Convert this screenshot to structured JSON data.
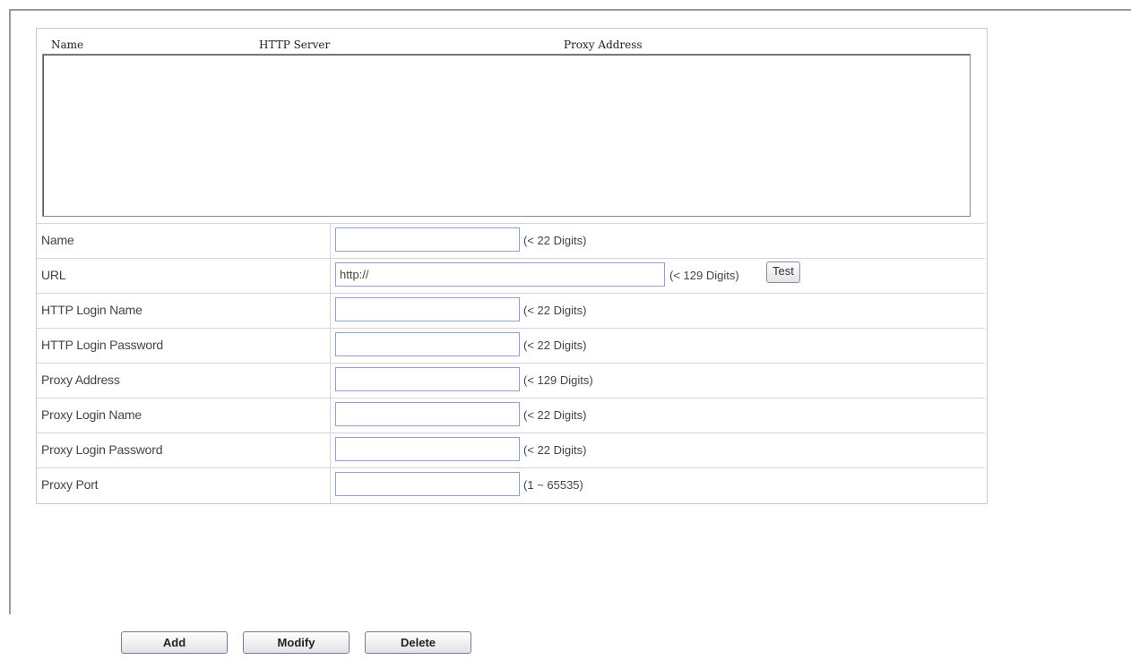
{
  "list": {
    "columns": [
      "Name",
      "HTTP Server",
      "Proxy Address"
    ]
  },
  "form": {
    "rows": [
      {
        "label": "Name",
        "value": "",
        "hint": "(< 22 Digits)"
      },
      {
        "label": "URL",
        "value": "http://",
        "hint": "(< 129 Digits)",
        "button": "Test"
      },
      {
        "label": "HTTP Login Name",
        "value": "",
        "hint": "(< 22 Digits)"
      },
      {
        "label": "HTTP Login Password",
        "value": "",
        "hint": "(< 22 Digits)"
      },
      {
        "label": "Proxy Address",
        "value": "",
        "hint": "(< 129 Digits)"
      },
      {
        "label": "Proxy Login Name",
        "value": "",
        "hint": "(< 22 Digits)"
      },
      {
        "label": "Proxy Login Password",
        "value": "",
        "hint": "(< 22 Digits)"
      },
      {
        "label": "Proxy Port",
        "value": "",
        "hint": "(1 ~ 65535)"
      }
    ]
  },
  "actions": {
    "add_label": "Add",
    "modify_label": "Modify",
    "delete_label": "Delete"
  }
}
